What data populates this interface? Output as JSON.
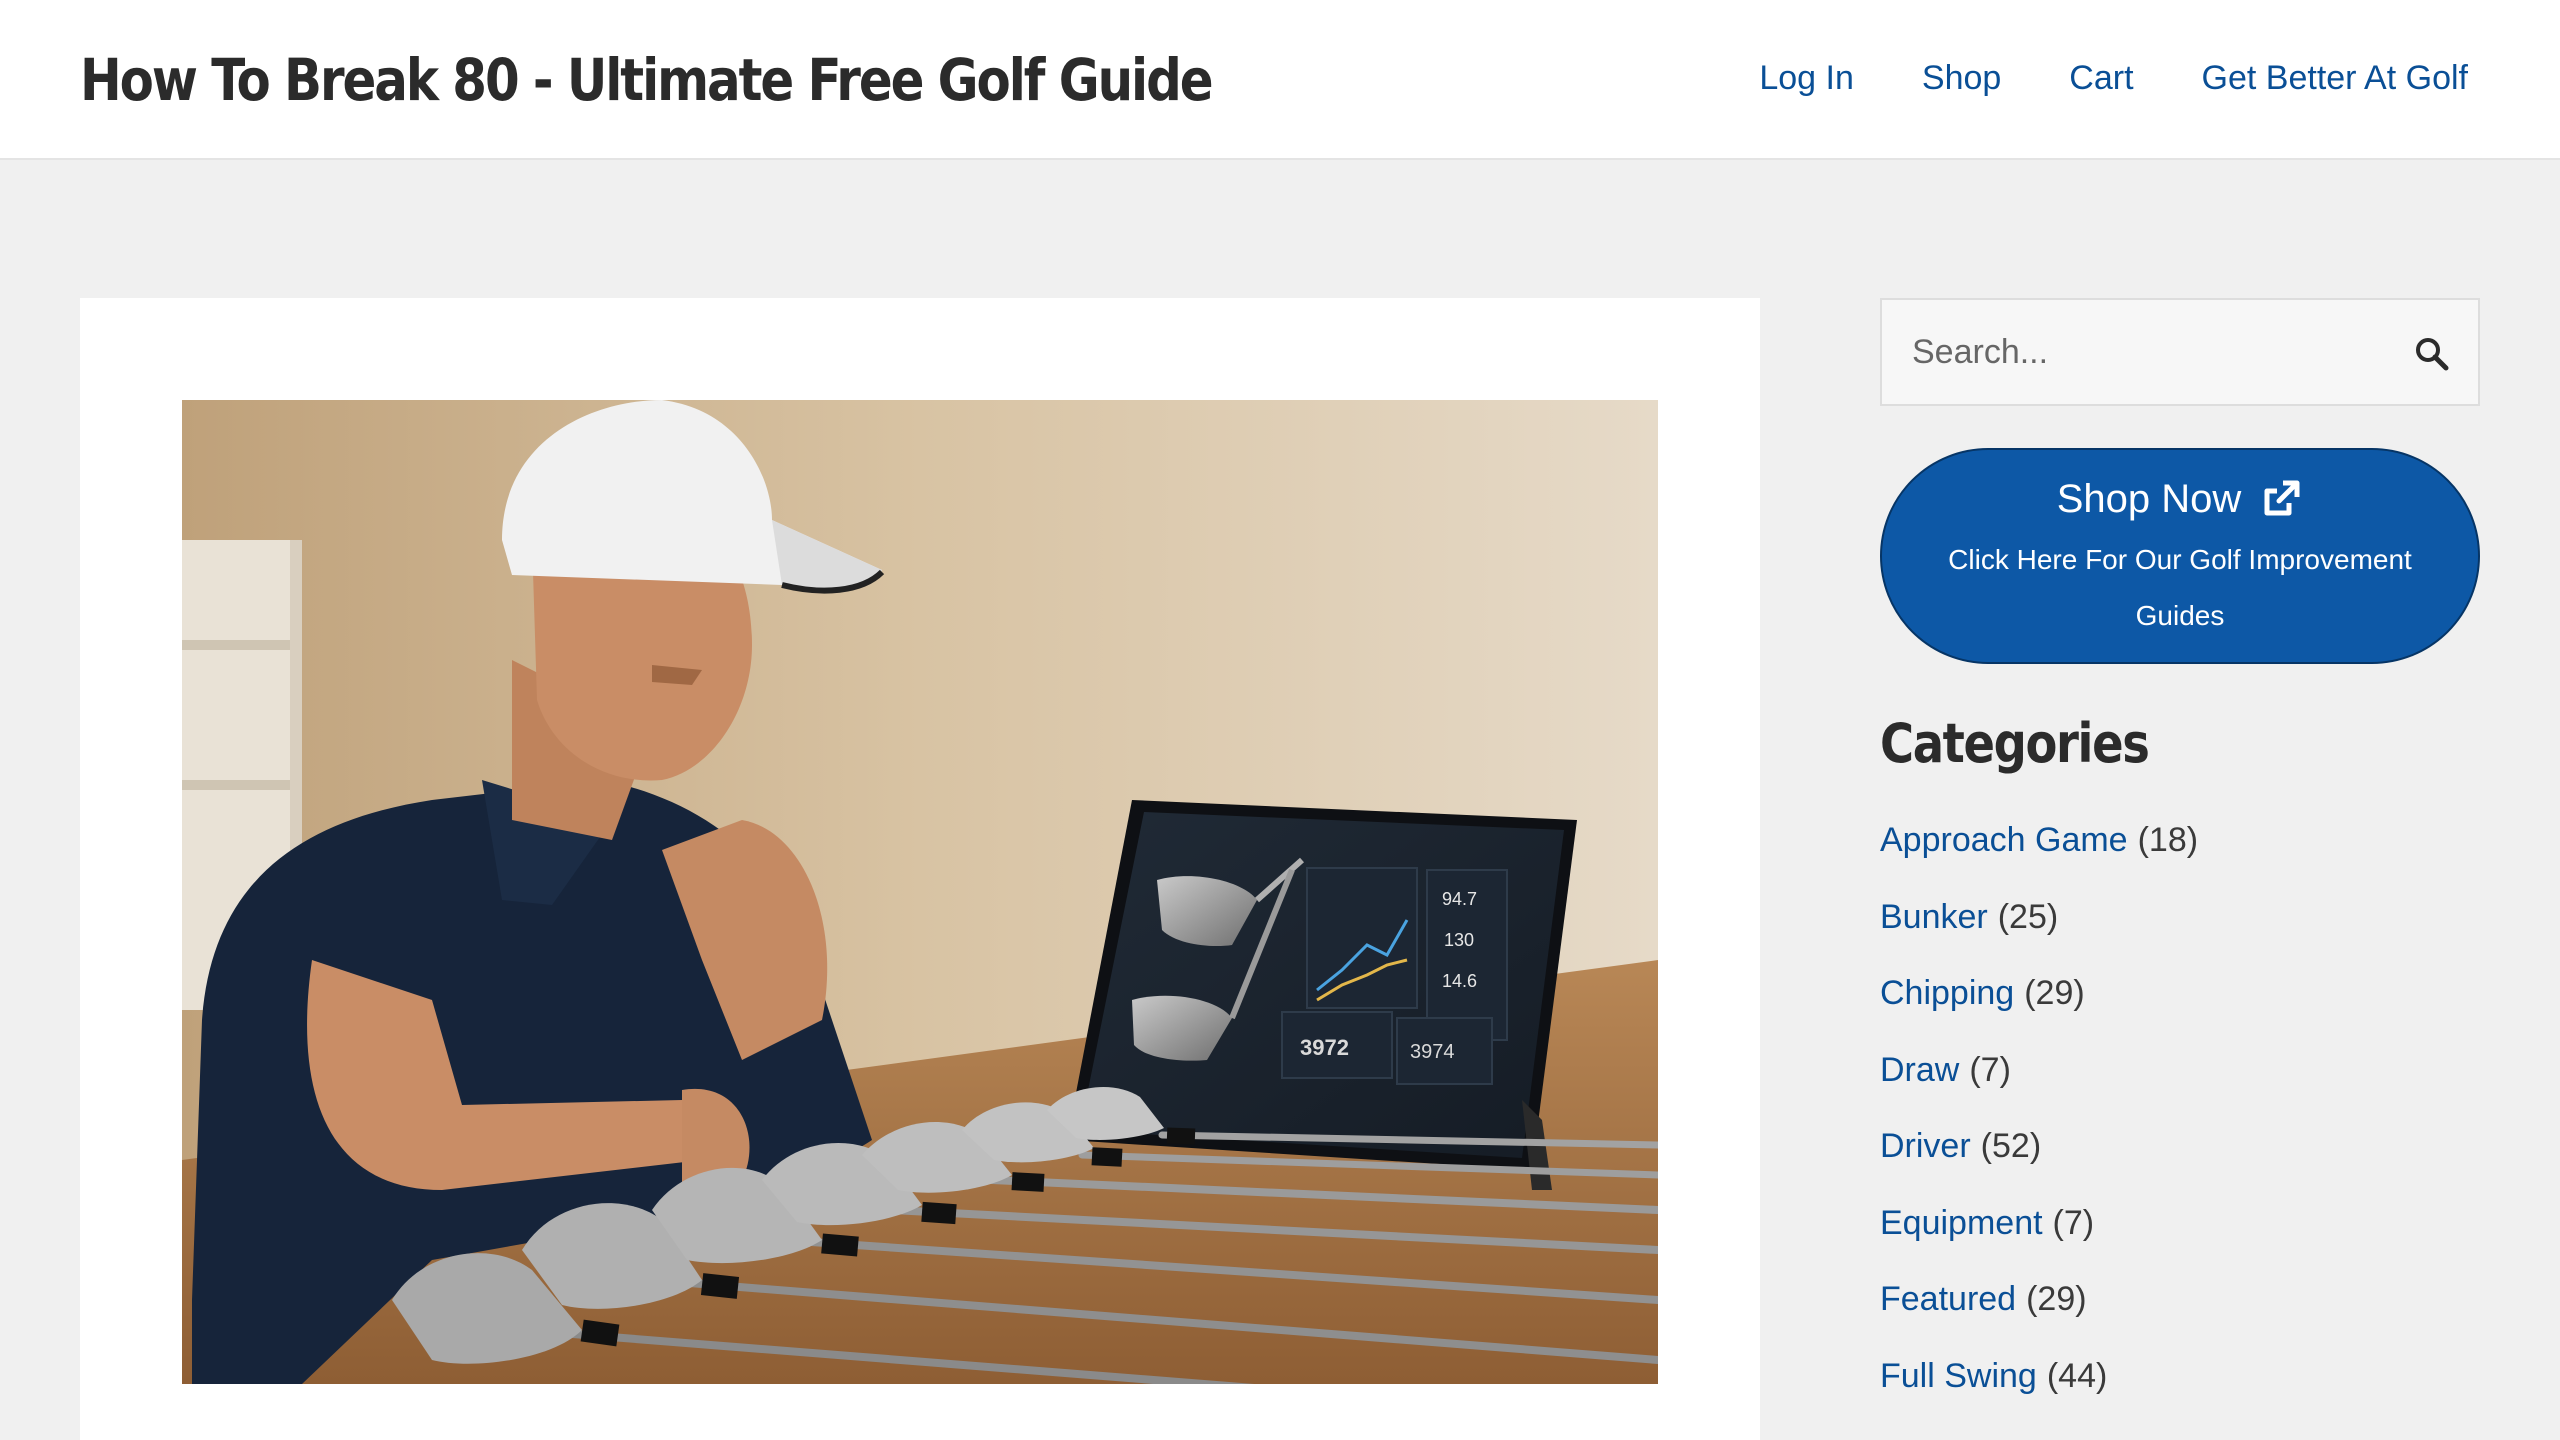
{
  "site": {
    "title": "How To Break 80 - Ultimate Free Golf Guide"
  },
  "nav": [
    {
      "label": "Log In"
    },
    {
      "label": "Shop"
    },
    {
      "label": "Cart"
    },
    {
      "label": "Get Better At Golf"
    }
  ],
  "featured_image": {
    "description_icon": "golfer-with-irons-and-tablet-image",
    "tablet_stats": [
      "94.7",
      "130",
      "14.6",
      "3972",
      "3974"
    ]
  },
  "search": {
    "placeholder": "Search...",
    "icon": "search-icon"
  },
  "shop_button": {
    "title": "Shop Now",
    "subtitle": "Click Here For Our Golf Improvement Guides",
    "icon": "external-link-icon"
  },
  "categories": {
    "title": "Categories",
    "items": [
      {
        "label": "Approach Game",
        "count": "(18)"
      },
      {
        "label": "Bunker",
        "count": "(25)"
      },
      {
        "label": "Chipping",
        "count": "(29)"
      },
      {
        "label": "Draw",
        "count": "(7)"
      },
      {
        "label": "Driver",
        "count": "(52)"
      },
      {
        "label": "Equipment",
        "count": "(7)"
      },
      {
        "label": "Featured",
        "count": "(29)"
      },
      {
        "label": "Full Swing",
        "count": "(44)"
      }
    ]
  },
  "colors": {
    "link": "#0a4f96",
    "shop_button_bg": "#0d58a6",
    "page_bg": "#f0f0f0",
    "heading": "#2b2b2b"
  }
}
